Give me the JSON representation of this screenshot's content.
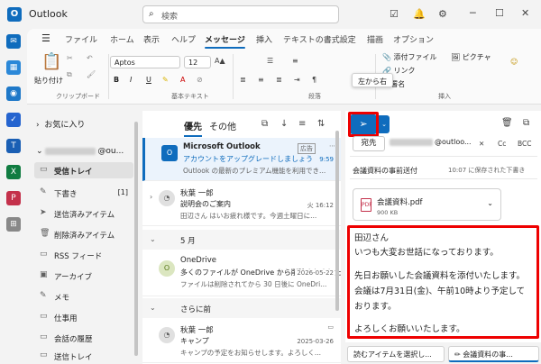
{
  "app": {
    "title": "Outlook",
    "logo_letter": "O"
  },
  "search": {
    "placeholder": "検索"
  },
  "ribbon_tabs": [
    "ファイル",
    "ホーム",
    "表示",
    "ヘルプ",
    "メッセージ",
    "挿入",
    "テキストの書式設定",
    "描画",
    "オプション"
  ],
  "active_ribbon_tab": "メッセージ",
  "ribbon": {
    "paste_label": "貼り付け",
    "clipboard_group": "クリップボード",
    "font_name": "Aptos",
    "font_size": "12",
    "basic_text_group": "基本テキスト",
    "paragraph_group": "段落",
    "rtl_tooltip": "左から右",
    "attach_file": "添付ファイル",
    "picture": "ピクチャ",
    "link": "リンク",
    "signature": "署名",
    "insert_group": "挿入"
  },
  "folders": {
    "favorites": "お気に入り",
    "account_suffix": "@ou...",
    "items": [
      {
        "label": "受信トレイ",
        "count": "",
        "icon": "inbox-icon",
        "selected": true
      },
      {
        "label": "下書き",
        "count": "[1]",
        "icon": "draft-icon",
        "selected": false
      },
      {
        "label": "送信済みアイテム",
        "count": "",
        "icon": "send-icon",
        "selected": false
      },
      {
        "label": "削除済みアイテム",
        "count": "",
        "icon": "trash-icon",
        "selected": false
      },
      {
        "label": "RSS フィード",
        "count": "",
        "icon": "rss-icon",
        "selected": false
      },
      {
        "label": "アーカイブ",
        "count": "",
        "icon": "archive-icon",
        "selected": false
      },
      {
        "label": "メモ",
        "count": "",
        "icon": "note-icon",
        "selected": false
      },
      {
        "label": "仕事用",
        "count": "",
        "icon": "folder-icon",
        "selected": false
      },
      {
        "label": "会話の履歴",
        "count": "",
        "icon": "folder-icon",
        "selected": false
      },
      {
        "label": "送信トレイ",
        "count": "",
        "icon": "outbox-icon",
        "selected": false
      }
    ]
  },
  "maillist": {
    "tabs": [
      "優先",
      "その他"
    ],
    "messages": [
      {
        "from": "Microsoft Outlook",
        "subject": "アカウントをアップグレードしましょう",
        "preview": "Outlook の最新のプレミアム機能を利用でき...",
        "time": "9:59",
        "badge": "広告"
      },
      {
        "from": "秋葉 一郎",
        "subject": "説明会のご案内",
        "preview": "田辺さん はいお疲れ様です。今週土曜日に...",
        "time": "火 16:12",
        "badge": ""
      }
    ],
    "group_may": "5 月",
    "may_messages": [
      {
        "from": "OneDrive",
        "subject": "多くのファイルが OneDrive から削除されました",
        "preview": "ファイルは削除されてから 30 日後に OneDri...",
        "time": "2026-05-22",
        "avatar": "O"
      }
    ],
    "group_earlier": "さらに前",
    "earlier_messages": [
      {
        "from": "秋葉 一郎",
        "subject": "キャンプ",
        "preview": "キャンプの予定をお知らせします。よろしく...",
        "time": "2025-03-26"
      }
    ]
  },
  "compose": {
    "to_label": "宛先",
    "to_suffix": "@outloo...",
    "cc": "Cc",
    "bcc": "BCC",
    "subject": "会議資料の事前送付",
    "saved": "10:07 に保存された下書き",
    "attachment": {
      "name": "会議資料.pdf",
      "size": "900 KB",
      "icon_text": "PDF"
    },
    "body": [
      "田辺さん",
      "いつも大変お世話になっております。",
      "",
      "先日お願いした会議資料を添付いたします。",
      "会議は7月31日(金)、午前10時より予定して",
      "おります。",
      "",
      "よろしくお願いいたします。"
    ]
  },
  "bottom_tabs": [
    "読むアイテムを選択し...",
    "会議資料の事..."
  ],
  "colors": {
    "accent": "#0f6cbd",
    "highlight_border": "#ee0000"
  }
}
